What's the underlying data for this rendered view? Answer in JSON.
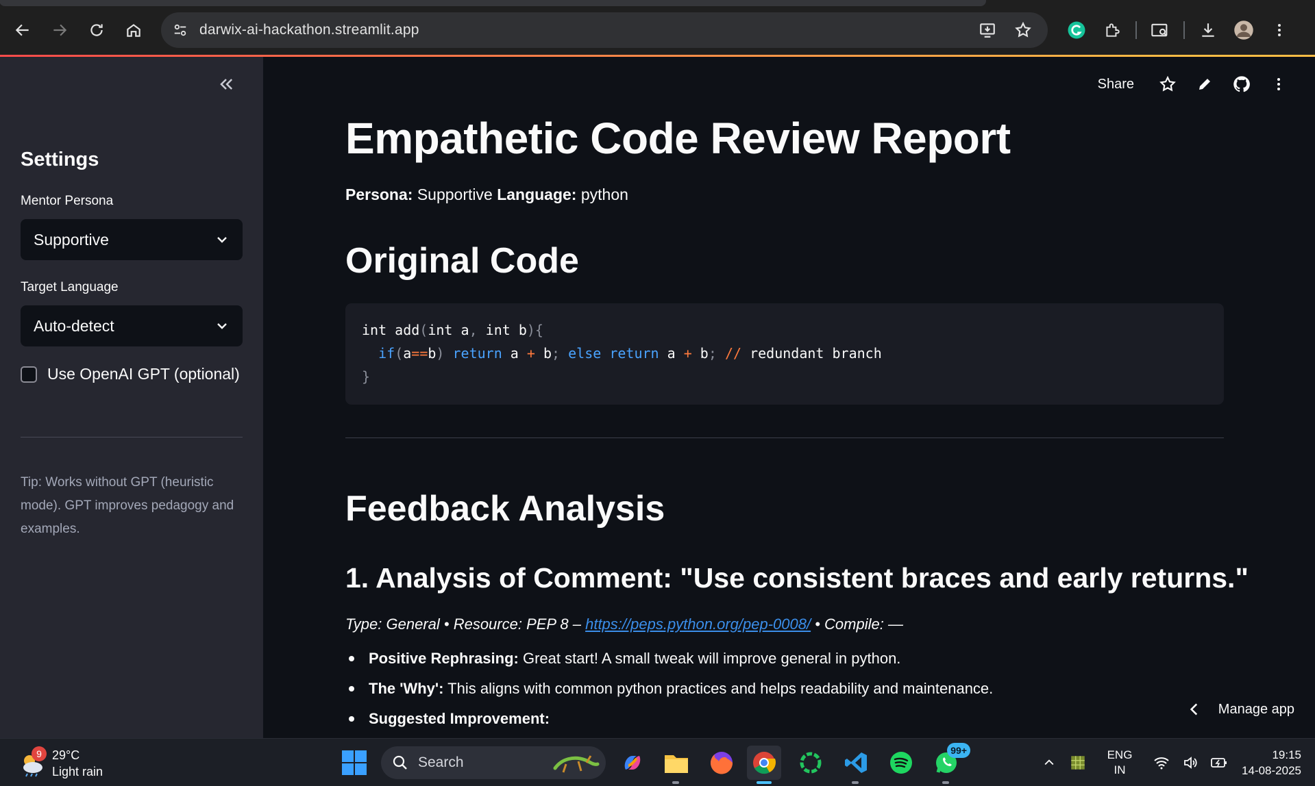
{
  "browser": {
    "url": "darwix-ai-hackathon.streamlit.app"
  },
  "sidebar": {
    "title": "Settings",
    "persona_label": "Mentor Persona",
    "persona_value": "Supportive",
    "language_label": "Target Language",
    "language_value": "Auto-detect",
    "gpt_checkbox_label": "Use OpenAI GPT (optional)",
    "gpt_checked": false,
    "tip": "Tip: Works without GPT (heuristic mode). GPT improves pedagogy and examples."
  },
  "topbar": {
    "share_label": "Share"
  },
  "report": {
    "title": "Empathetic Code Review Report",
    "persona_key": "Persona:",
    "persona_value": "Supportive",
    "language_key": "Language:",
    "language_value": "python",
    "original_code_heading": "Original Code",
    "code_lines": [
      "int add(int a, int b){",
      "  if(a==b) return a + b; else return a + b; // redundant branch",
      "}"
    ],
    "feedback_heading": "Feedback Analysis",
    "comment_heading": "1. Analysis of Comment: \"Use consistent braces and early returns.\"",
    "type_line_prefix": "Type: General • Resource: PEP 8 – ",
    "type_line_link": "https://peps.python.org/pep-0008/",
    "type_line_suffix": " • Compile: —",
    "bullets": [
      {
        "key": "Positive Rephrasing:",
        "text": " Great start! A small tweak will improve general in python."
      },
      {
        "key": "The 'Why':",
        "text": " This aligns with common python practices and helps readability and maintenance."
      },
      {
        "key": "Suggested Improvement:",
        "text": ""
      }
    ]
  },
  "manage_app_label": "Manage app",
  "taskbar": {
    "weather_badge": "9",
    "temperature": "29°C",
    "weather_desc": "Light rain",
    "search_label": "Search",
    "whatsapp_badge": "99+",
    "lang_line1": "ENG",
    "lang_line2": "IN",
    "time": "19:15",
    "date": "14-08-2025"
  },
  "colors": {
    "accent_red": "#ff4b4b",
    "link_blue": "#3b8eea",
    "keyword_blue": "#4aa3ff",
    "operator_orange": "#ff7a3d"
  }
}
